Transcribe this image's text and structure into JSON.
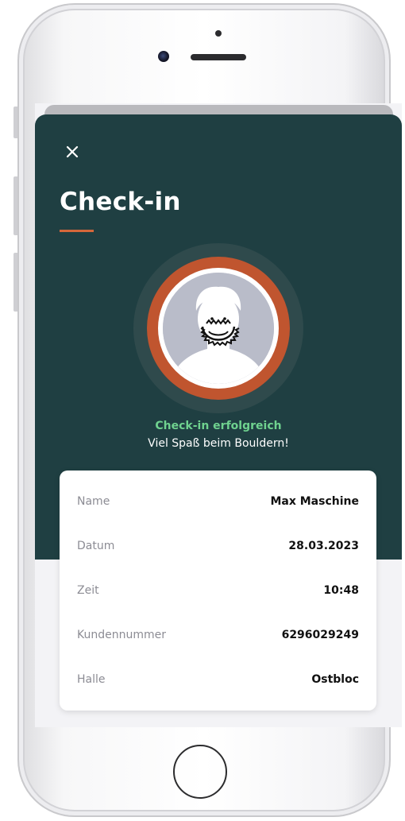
{
  "sheet": {
    "close_icon": "close-icon",
    "title": "Check-in"
  },
  "status": {
    "success": "Check-in erfolgreich",
    "message": "Viel Spaß beim Bouldern!"
  },
  "details": {
    "rows": [
      {
        "label": "Name",
        "value": "Max Maschine"
      },
      {
        "label": "Datum",
        "value": "28.03.2023"
      },
      {
        "label": "Zeit",
        "value": "10:48"
      },
      {
        "label": "Kundennummer",
        "value": "6296029249"
      },
      {
        "label": "Halle",
        "value": "Ostbloc"
      }
    ]
  },
  "colors": {
    "header_bg": "#1f3f42",
    "accent": "#d5673a",
    "ring": "#c0552f",
    "success": "#6fd28f"
  }
}
